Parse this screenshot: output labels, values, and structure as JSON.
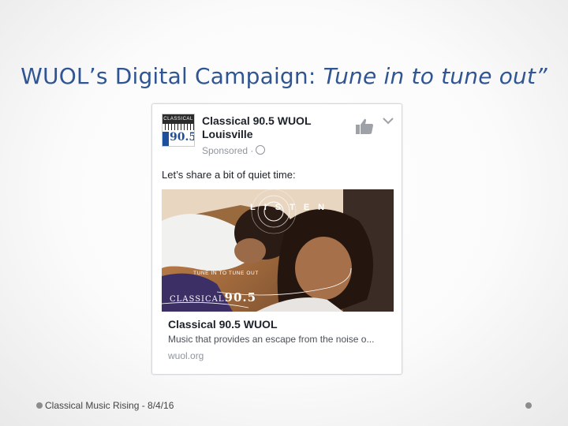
{
  "slide": {
    "title_main": "WUOL’s Digital Campaign: ",
    "title_italic": "Tune in to tune out”",
    "footer": "Classical Music Rising - 8/4/16"
  },
  "post": {
    "avatar_label": "CLASSICAL",
    "avatar_freq": "90.5",
    "page_name": "Classical 90.5 WUOL Louisville",
    "sponsored": "Sponsored ·",
    "text": "Let’s share a bit of quiet time:",
    "icons": {
      "like": "thumbs-up-icon",
      "menu": "chevron-down-icon",
      "privacy": "globe-icon"
    }
  },
  "ad_image": {
    "listen": "LISTEN",
    "tagline": "TUNE IN TO TUNE OUT",
    "brand_word": "CLASSICAL",
    "brand_freq": "90.5"
  },
  "link": {
    "title": "Classical 90.5 WUOL",
    "description": "Music that provides an escape from the noise o...",
    "domain": "wuol.org"
  },
  "colors": {
    "title": "#2f5592",
    "brand_blue": "#1e4f9c"
  }
}
